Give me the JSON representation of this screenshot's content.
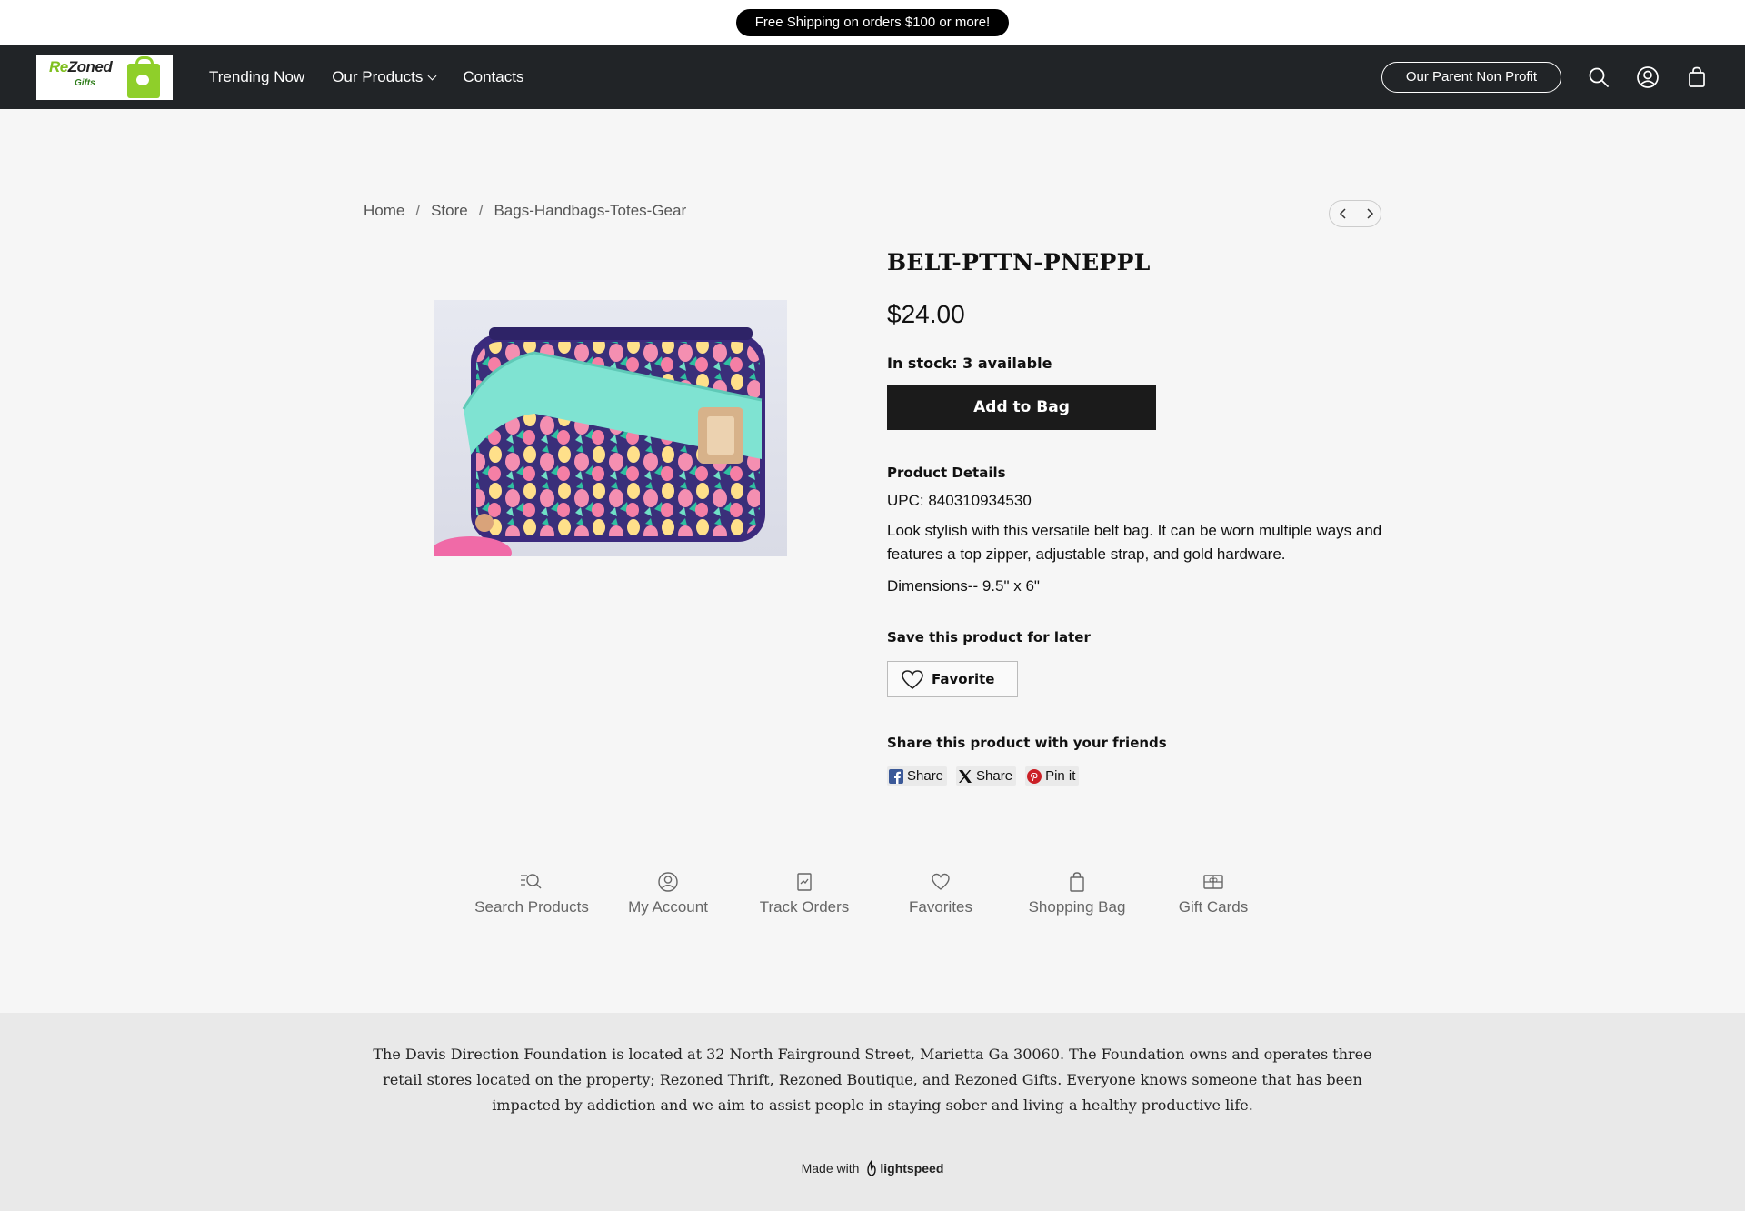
{
  "announcement": "Free Shipping on orders $100 or more!",
  "logo": {
    "wordmark_re": "Re",
    "wordmark_rest": "Zoned",
    "sub": "Gifts"
  },
  "nav": {
    "trending": "Trending Now",
    "products": "Our Products",
    "contacts": "Contacts"
  },
  "header": {
    "parent_button": "Our Parent Non Profit",
    "icons": [
      "search-icon",
      "account-icon",
      "bag-icon"
    ]
  },
  "breadcrumb": {
    "home": "Home",
    "store": "Store",
    "category": "Bags-Handbags-Totes-Gear",
    "separator": "/"
  },
  "product": {
    "title": "BELT-PTTN-PNEPPL",
    "price": "$24.00",
    "stock": "In stock: 3 available",
    "add_button": "Add to Bag",
    "details_heading": "Product Details",
    "upc": "UPC: 840310934530",
    "description": "Look stylish with this versatile belt bag. It can be worn multiple ways and features a top zipper, adjustable strap, and gold hardware.",
    "dimensions": "Dimensions-- 9.5\" x 6\"",
    "save_heading": "Save this product for later",
    "favorite_label": "Favorite",
    "share_heading": "Share this product with your friends",
    "share": {
      "facebook": "Share",
      "x": "Share",
      "pinterest": "Pin it"
    }
  },
  "quicklinks": [
    "Search Products",
    "My Account",
    "Track Orders",
    "Favorites",
    "Shopping Bag",
    "Gift Cards"
  ],
  "footer": {
    "text": "The Davis Direction Foundation is located at 32 North Fairground Street, Marietta Ga 30060.  The Foundation owns and operates three retail stores located on the property; Rezoned Thrift, Rezoned Boutique, and Rezoned Gifts.  Everyone knows someone that has been impacted by addiction and we aim to assist people in staying sober and living a healthy productive life.",
    "made_with": "Made with",
    "brand": "lightspeed"
  }
}
